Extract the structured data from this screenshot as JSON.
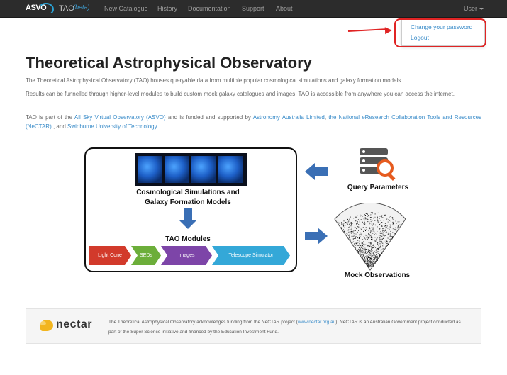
{
  "navbar": {
    "brand_logo_text": "ASVO",
    "brand_tao": "TAO",
    "brand_beta": "(beta)",
    "items": [
      "New Catalogue",
      "History",
      "Documentation",
      "Support",
      "About"
    ],
    "user_label": "User"
  },
  "user_menu": {
    "items": [
      "Change your password",
      "Logout"
    ]
  },
  "main": {
    "title": "Theoretical Astrophysical Observatory",
    "paragraph1": "The Theoretical Astrophysical Observatory (TAO) houses queryable data from multiple popular cosmological simulations and galaxy formation models.",
    "paragraph2": "Results can be funnelled through higher-level modules to build custom mock galaxy catalogues and images. TAO is accessible from anywhere you can access the internet.",
    "paragraph3": {
      "t1": "TAO is part of the ",
      "link1": "All Sky Virtual Observatory (ASVO)",
      "t2": " and is funded and supported by ",
      "link2": "Astronomy Australia Limited",
      "t3": ", ",
      "link3": "the National eResearch Collaboration Tools and Resources (NeCTAR)",
      "t4": " , and ",
      "link4": "Swinburne University of Technology",
      "t5": "."
    }
  },
  "diagram": {
    "sim_label_line1": "Cosmological Simulations and",
    "sim_label_line2": "Galaxy Formation Models",
    "modules_label": "TAO Modules",
    "modules": [
      "Light Cone",
      "SEDs",
      "Images",
      "Telescope Simulator"
    ],
    "module_colors": [
      "#d23a2b",
      "#6cae3a",
      "#7d45a8",
      "#34a8d8"
    ],
    "query_label": "Query Parameters",
    "mock_label": "Mock Observations",
    "arrow_color": "#3a6fb5"
  },
  "footer": {
    "logo_text": "nectar",
    "text1": "The Theoretical Astrophysical Observatory acknowledges funding from the NeCTAR project (",
    "link": "www.nectar.org.au",
    "text2": "). NeCTAR is an Australian Government project conducted as part of the Super Science initiative and financed by the Education Investment Fund."
  }
}
